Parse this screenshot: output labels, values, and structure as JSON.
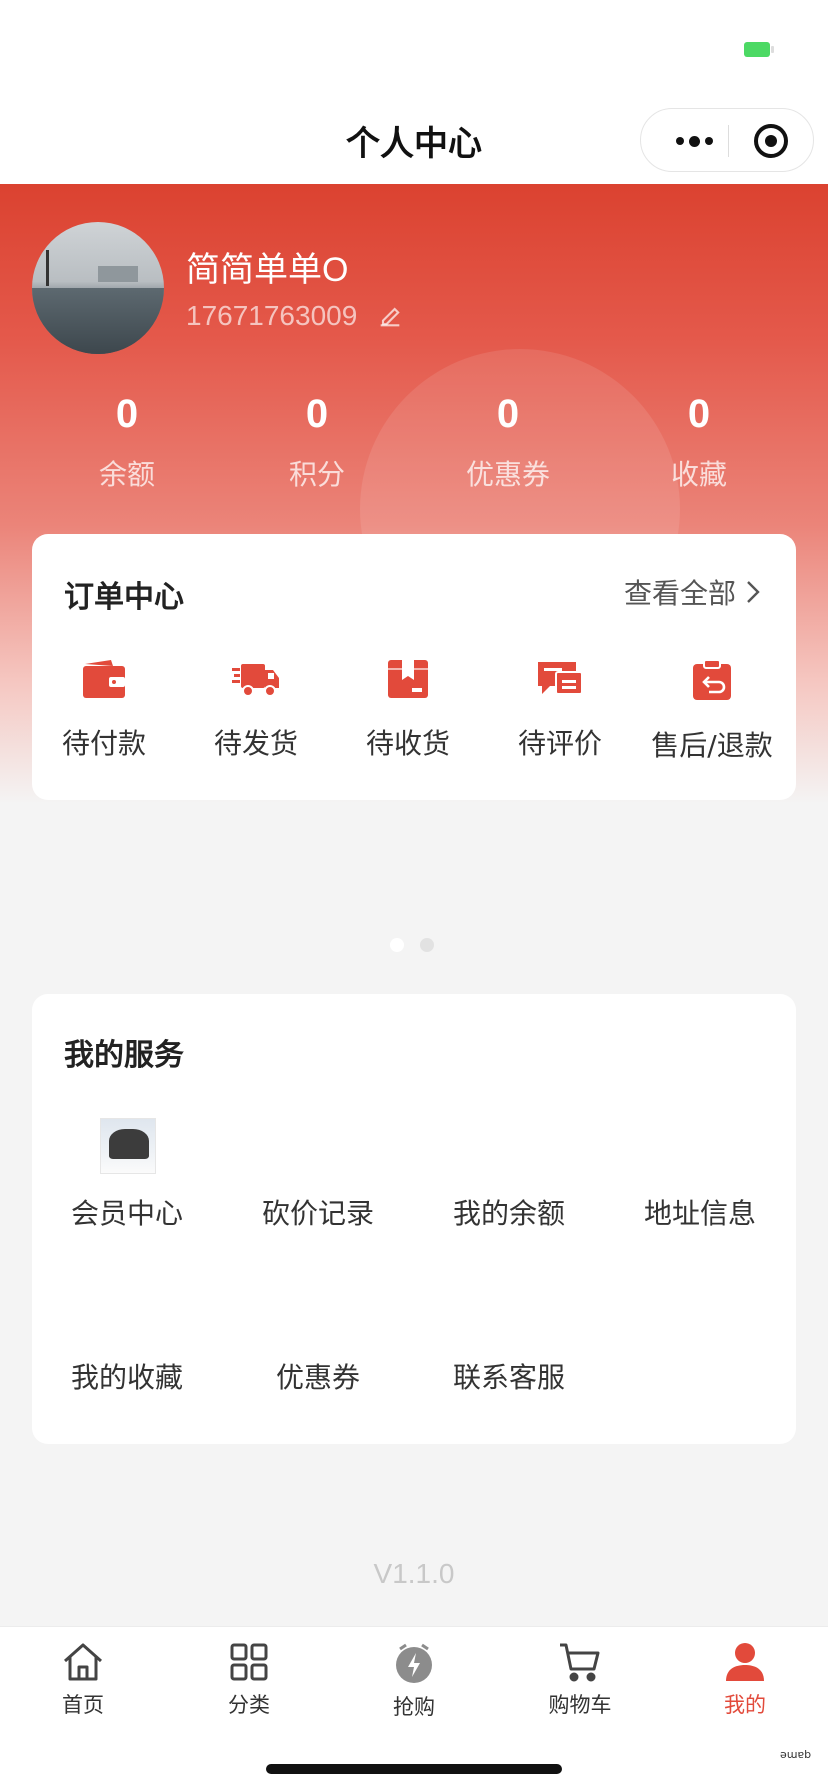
{
  "nav": {
    "title": "个人中心"
  },
  "profile": {
    "username": "简简单单O",
    "phone": "17671763009"
  },
  "stats": [
    {
      "value": "0",
      "label": "余额"
    },
    {
      "value": "0",
      "label": "积分"
    },
    {
      "value": "0",
      "label": "优惠券"
    },
    {
      "value": "0",
      "label": "收藏"
    }
  ],
  "orders": {
    "title": "订单中心",
    "view_all": "查看全部",
    "items": [
      {
        "label": "待付款",
        "icon": "wallet-icon"
      },
      {
        "label": "待发货",
        "icon": "truck-icon"
      },
      {
        "label": "待收货",
        "icon": "package-icon"
      },
      {
        "label": "待评价",
        "icon": "comment-icon"
      },
      {
        "label": "售后/退款",
        "icon": "refund-icon"
      }
    ]
  },
  "carousel": {
    "pages": 2,
    "active_index": 0
  },
  "services": {
    "title": "我的服务",
    "items": [
      "会员中心",
      "砍价记录",
      "我的余额",
      "地址信息",
      "我的收藏",
      "优惠券",
      "联系客服"
    ]
  },
  "version": "V1.1.0",
  "tabs": [
    {
      "label": "首页",
      "icon": "home-icon"
    },
    {
      "label": "分类",
      "icon": "grid-icon"
    },
    {
      "label": "抢购",
      "icon": "flash-clock-icon"
    },
    {
      "label": "购物车",
      "icon": "cart-icon"
    },
    {
      "label": "我的",
      "icon": "user-icon",
      "active": true
    }
  ],
  "colors": {
    "accent": "#e24a3b",
    "header_red": "#db4230",
    "background": "#f4f4f4"
  }
}
